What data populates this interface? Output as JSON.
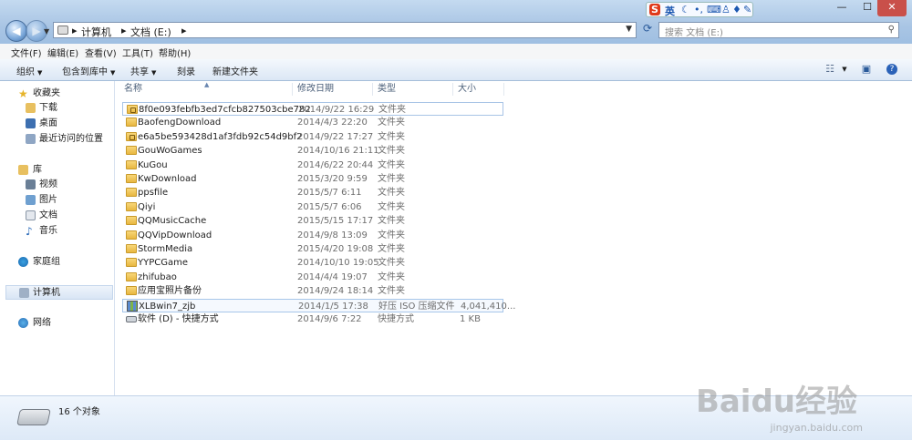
{
  "address": {
    "crumbs": [
      "计算机",
      "文档 (E:)"
    ]
  },
  "search": {
    "placeholder": "搜索 文档 (E:)"
  },
  "ime": {
    "logo": "S",
    "mode": "英"
  },
  "window_controls": {
    "minimize": "—",
    "maximize": "☐",
    "close": "✕"
  },
  "menu": [
    "文件(F)",
    "编辑(E)",
    "查看(V)",
    "工具(T)",
    "帮助(H)"
  ],
  "toolbar": {
    "organize": "组织",
    "include": "包含到库中",
    "share": "共享",
    "burn": "刻录",
    "new_folder": "新建文件夹"
  },
  "nav": {
    "favorites": {
      "title": "收藏夹",
      "items": [
        "下载",
        "桌面",
        "最近访问的位置"
      ]
    },
    "libraries": {
      "title": "库",
      "items": [
        "视频",
        "图片",
        "文档",
        "音乐"
      ]
    },
    "homegroup": "家庭组",
    "computer": "计算机",
    "network": "网络"
  },
  "columns": [
    "名称",
    "修改日期",
    "类型",
    "大小"
  ],
  "files": [
    {
      "name": "8f0e093febfb3ed7cfcb827503cbe782",
      "date": "2014/9/22 16:29",
      "type": "文件夹",
      "size": "",
      "icon": "folder-locked-icon"
    },
    {
      "name": "BaofengDownload",
      "date": "2014/4/3 22:20",
      "type": "文件夹",
      "size": "",
      "icon": "folder-icon"
    },
    {
      "name": "e6a5be593428d1af3fdb92c54d9bf2",
      "date": "2014/9/22 17:27",
      "type": "文件夹",
      "size": "",
      "icon": "folder-locked-icon"
    },
    {
      "name": "GouWoGames",
      "date": "2014/10/16 21:11",
      "type": "文件夹",
      "size": "",
      "icon": "folder-icon"
    },
    {
      "name": "KuGou",
      "date": "2014/6/22 20:44",
      "type": "文件夹",
      "size": "",
      "icon": "folder-icon"
    },
    {
      "name": "KwDownload",
      "date": "2015/3/20 9:59",
      "type": "文件夹",
      "size": "",
      "icon": "folder-icon"
    },
    {
      "name": "ppsfile",
      "date": "2015/5/7 6:11",
      "type": "文件夹",
      "size": "",
      "icon": "folder-icon"
    },
    {
      "name": "Qiyi",
      "date": "2015/5/7 6:06",
      "type": "文件夹",
      "size": "",
      "icon": "folder-icon"
    },
    {
      "name": "QQMusicCache",
      "date": "2015/5/15 17:17",
      "type": "文件夹",
      "size": "",
      "icon": "folder-icon"
    },
    {
      "name": "QQVipDownload",
      "date": "2014/9/8 13:09",
      "type": "文件夹",
      "size": "",
      "icon": "folder-icon"
    },
    {
      "name": "StormMedia",
      "date": "2015/4/20 19:08",
      "type": "文件夹",
      "size": "",
      "icon": "folder-icon"
    },
    {
      "name": "YYPCGame",
      "date": "2014/10/10 19:05",
      "type": "文件夹",
      "size": "",
      "icon": "folder-icon"
    },
    {
      "name": "zhifubao",
      "date": "2014/4/4 19:07",
      "type": "文件夹",
      "size": "",
      "icon": "folder-icon"
    },
    {
      "name": "应用宝照片备份",
      "date": "2014/9/24 18:14",
      "type": "文件夹",
      "size": "",
      "icon": "folder-icon"
    },
    {
      "name": "XLBwin7_zjb",
      "date": "2014/1/5 17:38",
      "type": "好压 ISO 压缩文件",
      "size": "4,041,410...",
      "icon": "archive-icon"
    },
    {
      "name": "软件 (D) - 快捷方式",
      "date": "2014/9/6 7:22",
      "type": "快捷方式",
      "size": "1 KB",
      "icon": "drive-shortcut-icon"
    }
  ],
  "status": {
    "count": "16 个对象"
  },
  "watermark": {
    "logo": "Baidu经验",
    "url": "jingyan.baidu.com"
  }
}
